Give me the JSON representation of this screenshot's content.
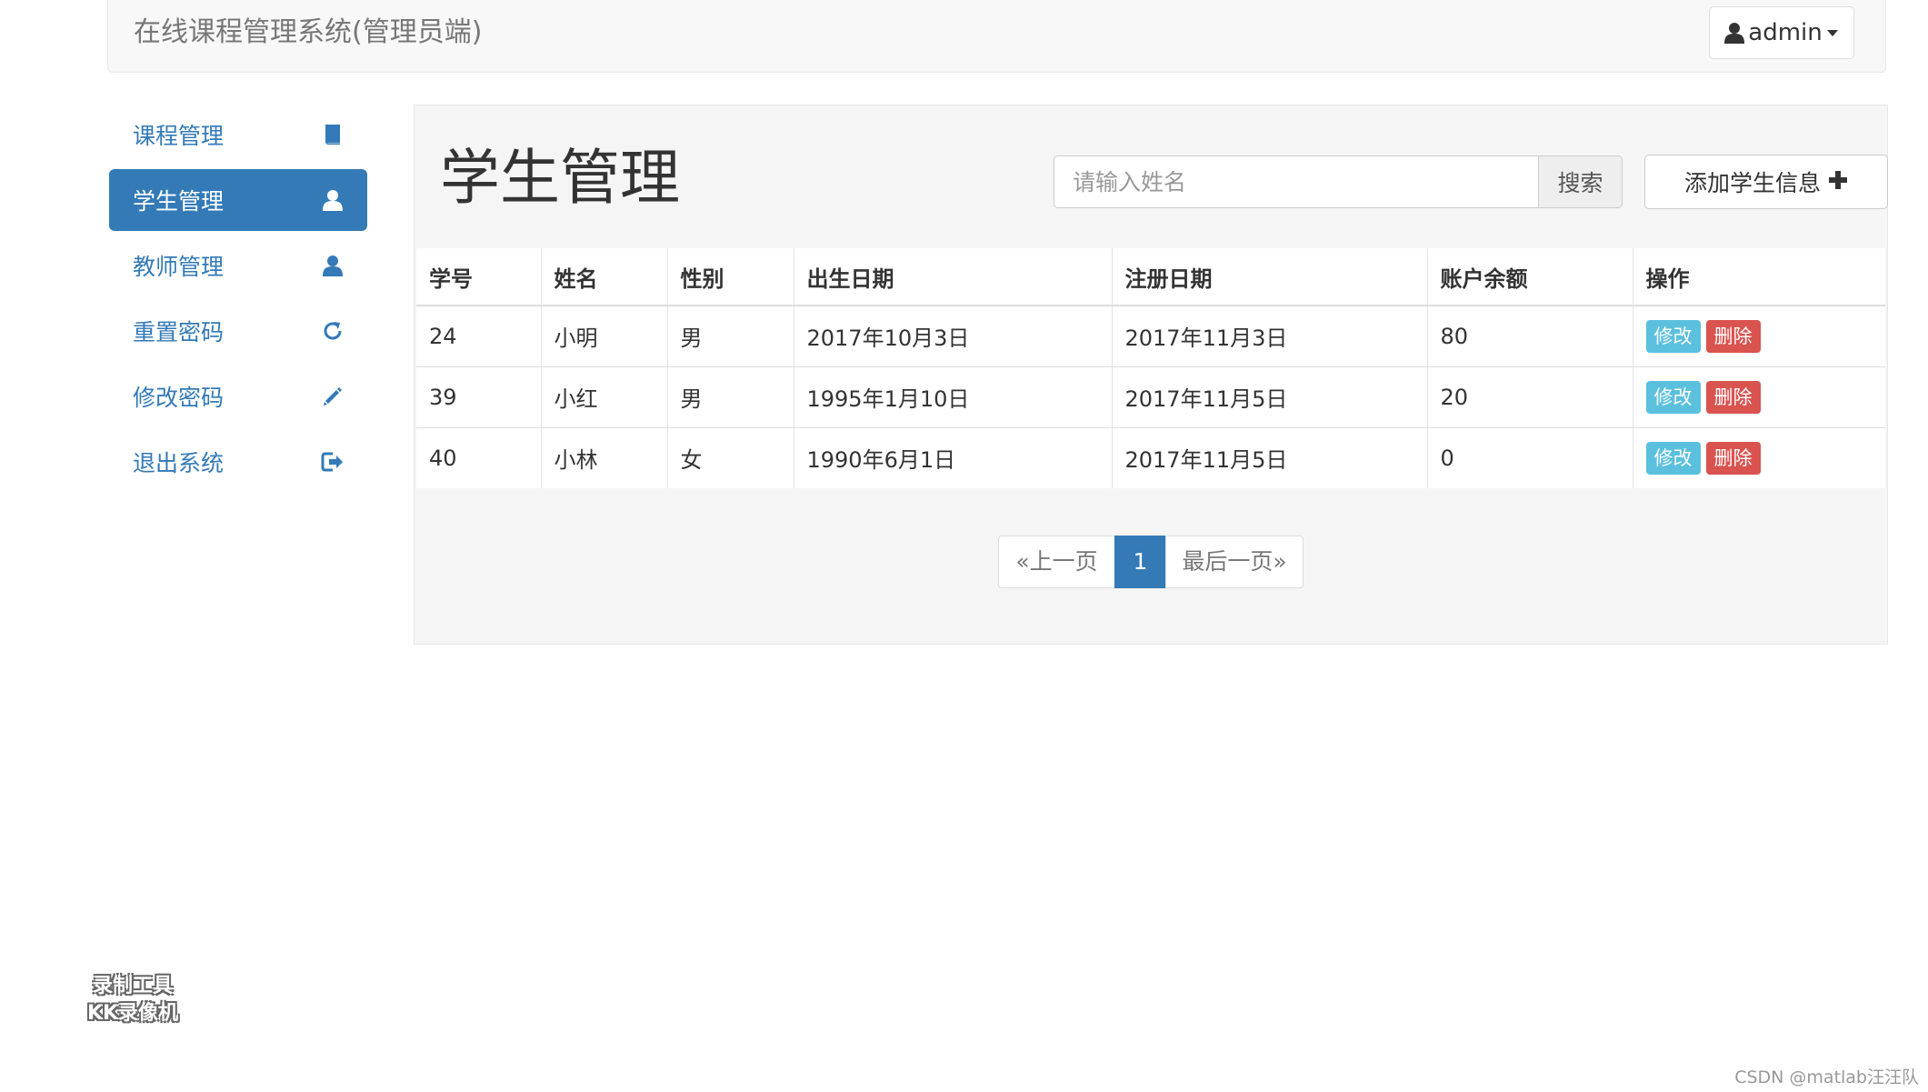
{
  "header": {
    "brand": "在线课程管理系统(管理员端)",
    "user": "admin"
  },
  "sidebar": {
    "items": [
      {
        "label": "课程管理",
        "icon": "book-icon",
        "active": false
      },
      {
        "label": "学生管理",
        "icon": "user-icon",
        "active": true
      },
      {
        "label": "教师管理",
        "icon": "user-icon",
        "active": false
      },
      {
        "label": "重置密码",
        "icon": "refresh-icon",
        "active": false
      },
      {
        "label": "修改密码",
        "icon": "pencil-icon",
        "active": false
      },
      {
        "label": "退出系统",
        "icon": "logout-icon",
        "active": false
      }
    ]
  },
  "main": {
    "title": "学生管理",
    "search": {
      "placeholder": "请输入姓名",
      "value": "",
      "button": "搜索"
    },
    "add_button": "添加学生信息",
    "table": {
      "columns": [
        "学号",
        "姓名",
        "性别",
        "出生日期",
        "注册日期",
        "账户余额",
        "操作"
      ],
      "rows": [
        {
          "id": "24",
          "name": "小明",
          "gender": "男",
          "birth": "2017年10月3日",
          "register": "2017年11月3日",
          "balance": "80"
        },
        {
          "id": "39",
          "name": "小红",
          "gender": "男",
          "birth": "1995年1月10日",
          "register": "2017年11月5日",
          "balance": "20"
        },
        {
          "id": "40",
          "name": "小林",
          "gender": "女",
          "birth": "1990年6月1日",
          "register": "2017年11月5日",
          "balance": "0"
        }
      ],
      "edit_label": "修改",
      "delete_label": "删除"
    },
    "pagination": {
      "prev": "«上一页",
      "current": "1",
      "last": "最后一页»"
    }
  },
  "watermark": {
    "line1": "录制工具",
    "line2": "KK录像机"
  },
  "credit": "CSDN @matlab汪汪队",
  "colors": {
    "primary": "#337ab7",
    "info": "#5bc0de",
    "danger": "#d9534f",
    "panel_bg": "#f5f5f5",
    "navbar_bg": "#f8f8f8"
  }
}
